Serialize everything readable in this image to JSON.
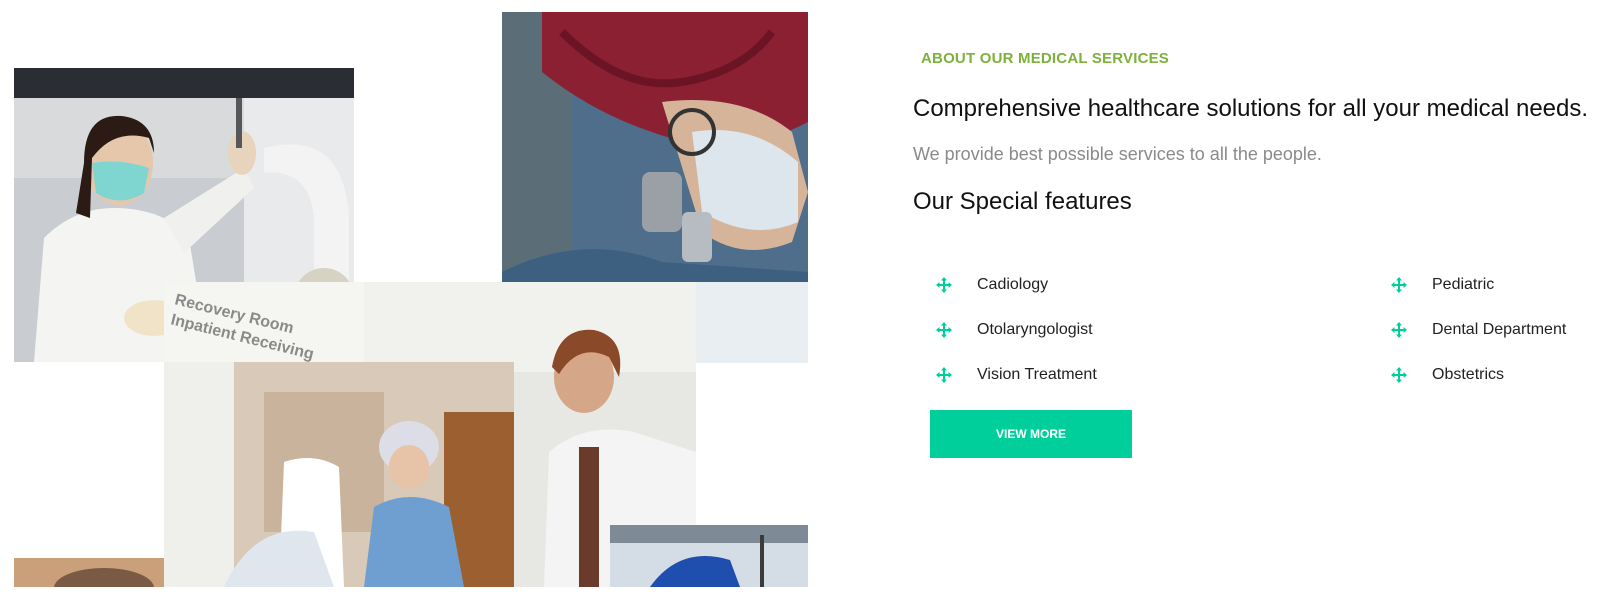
{
  "colors": {
    "accent_green": "#7cb13a",
    "accent_teal": "#00cf9b"
  },
  "about": {
    "eyebrow": "ABOUT OUR MEDICAL SERVICES",
    "headline": "Comprehensive healthcare solutions for all your medical needs.",
    "subline": "We provide best possible services to all the people.",
    "features_title": "Our Special features"
  },
  "features": {
    "left": [
      {
        "label": "Cadiology",
        "icon": "move-arrows-icon"
      },
      {
        "label": "Otolaryngologist",
        "icon": "move-arrows-icon"
      },
      {
        "label": "Vision Treatment",
        "icon": "move-arrows-icon"
      }
    ],
    "right": [
      {
        "label": "Pediatric",
        "icon": "move-arrows-icon"
      },
      {
        "label": "Dental Department",
        "icon": "move-arrows-icon"
      },
      {
        "label": "Obstetrics",
        "icon": "move-arrows-icon"
      }
    ]
  },
  "cta": {
    "label": "VIEW MORE"
  },
  "collage": {
    "sign_lines": [
      "Recovery Room",
      "Inpatient Receiving"
    ]
  }
}
